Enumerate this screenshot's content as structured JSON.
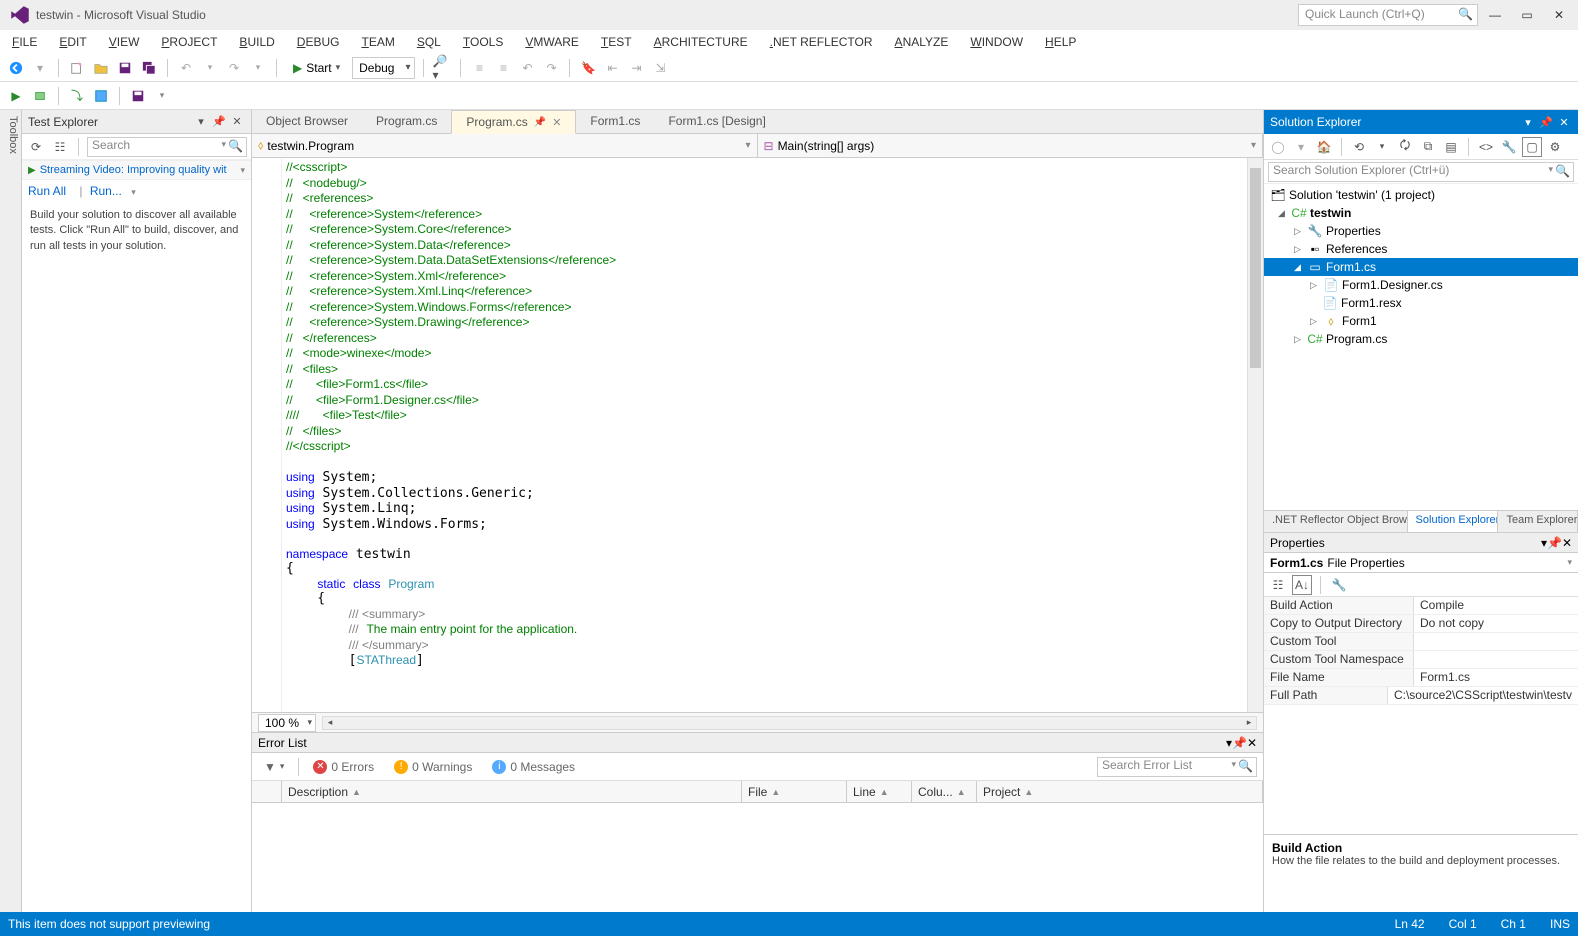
{
  "title": "testwin - Microsoft Visual Studio",
  "quicklaunch_placeholder": "Quick Launch (Ctrl+Q)",
  "menus": [
    "FILE",
    "EDIT",
    "VIEW",
    "PROJECT",
    "BUILD",
    "DEBUG",
    "TEAM",
    "SQL",
    "TOOLS",
    "VMWARE",
    "TEST",
    "ARCHITECTURE",
    ".NET REFLECTOR",
    "ANALYZE",
    "WINDOW",
    "HELP"
  ],
  "toolbar": {
    "start_label": "Start",
    "config": "Debug"
  },
  "toolbox_tab": "Toolbox",
  "test_explorer": {
    "title": "Test Explorer",
    "search_placeholder": "Search",
    "streaming": "Streaming Video: Improving quality wit",
    "run_all": "Run All",
    "run": "Run...",
    "hint": "Build your solution to discover all available tests. Click \"Run All\" to build, discover, and run all tests in your solution."
  },
  "tabs": [
    {
      "label": "Object Browser",
      "active": false
    },
    {
      "label": "Program.cs",
      "active": false
    },
    {
      "label": "Program.cs",
      "active": true,
      "pinned": true,
      "closable": true
    },
    {
      "label": "Form1.cs",
      "active": false
    },
    {
      "label": "Form1.cs [Design]",
      "active": false
    }
  ],
  "nav_left": "testwin.Program",
  "nav_right": "Main(string[] args)",
  "zoom": "100 %",
  "code_lines": [
    {
      "t": "//<csscript>",
      "cls": "c"
    },
    {
      "t": "//   <nodebug/>",
      "cls": "c"
    },
    {
      "t": "//   <references>",
      "cls": "c"
    },
    {
      "t": "//     <reference>System</reference>",
      "cls": "c"
    },
    {
      "t": "//     <reference>System.Core</reference>",
      "cls": "c"
    },
    {
      "t": "//     <reference>System.Data</reference>",
      "cls": "c"
    },
    {
      "t": "//     <reference>System.Data.DataSetExtensions</reference>",
      "cls": "c"
    },
    {
      "t": "//     <reference>System.Xml</reference>",
      "cls": "c"
    },
    {
      "t": "//     <reference>System.Xml.Linq</reference>",
      "cls": "c"
    },
    {
      "t": "//     <reference>System.Windows.Forms</reference>",
      "cls": "c"
    },
    {
      "t": "//     <reference>System.Drawing</reference>",
      "cls": "c"
    },
    {
      "t": "//   </references>",
      "cls": "c"
    },
    {
      "t": "//   <mode>winexe</mode>",
      "cls": "c"
    },
    {
      "t": "//   <files>",
      "cls": "c"
    },
    {
      "t": "//       <file>Form1.cs</file>",
      "cls": "c"
    },
    {
      "t": "//       <file>Form1.Designer.cs</file>",
      "cls": "c"
    },
    {
      "t": "////       <file>Test</file>",
      "cls": "c"
    },
    {
      "t": "//   </files>",
      "cls": "c"
    },
    {
      "t": "//</csscript>",
      "cls": "c"
    },
    {
      "t": "",
      "cls": ""
    }
  ],
  "code_using": [
    "System",
    "System.Collections.Generic",
    "System.Linq",
    "System.Windows.Forms"
  ],
  "code_ns": "testwin",
  "code_class": "Program",
  "code_summary": "The main entry point for the application.",
  "code_attr": "STAThread",
  "error_list": {
    "title": "Error List",
    "filter": "▼",
    "errors": "0 Errors",
    "warnings": "0 Warnings",
    "messages": "0 Messages",
    "search_placeholder": "Search Error List",
    "cols": [
      "",
      "Description",
      "File",
      "Line",
      "Colu...",
      "Project"
    ]
  },
  "solution_explorer": {
    "title": "Solution Explorer",
    "search_placeholder": "Search Solution Explorer (Ctrl+ü)",
    "tree": {
      "solution": "Solution 'testwin' (1 project)",
      "project": "testwin",
      "properties": "Properties",
      "references": "References",
      "form1": "Form1.cs",
      "form1_designer": "Form1.Designer.cs",
      "form1_resx": "Form1.resx",
      "form1_class": "Form1",
      "program": "Program.cs"
    },
    "bottom_tabs": [
      ".NET Reflector Object Brow...",
      "Solution Explorer",
      "Team Explorer"
    ]
  },
  "properties": {
    "title": "Properties",
    "subject_name": "Form1.cs",
    "subject_type": "File Properties",
    "rows": [
      {
        "name": "Build Action",
        "val": "Compile"
      },
      {
        "name": "Copy to Output Directory",
        "val": "Do not copy"
      },
      {
        "name": "Custom Tool",
        "val": ""
      },
      {
        "name": "Custom Tool Namespace",
        "val": ""
      },
      {
        "name": "File Name",
        "val": "Form1.cs"
      },
      {
        "name": "Full Path",
        "val": "C:\\source2\\CSScript\\testwin\\testv"
      }
    ],
    "desc_title": "Build Action",
    "desc_text": "How the file relates to the build and deployment processes."
  },
  "statusbar": {
    "msg": "This item does not support previewing",
    "ln": "Ln 42",
    "col": "Col 1",
    "ch": "Ch 1",
    "ins": "INS"
  }
}
